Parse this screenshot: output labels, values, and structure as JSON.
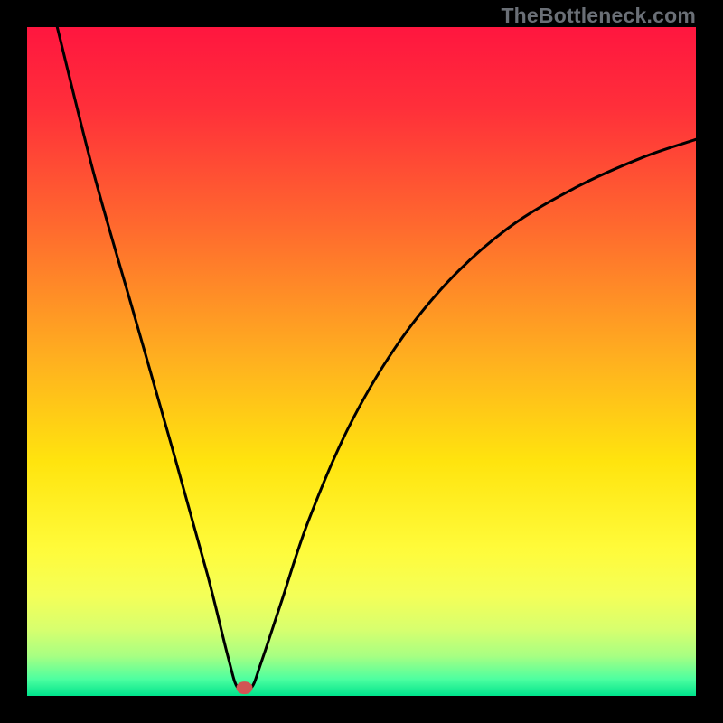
{
  "watermark": "TheBottleneck.com",
  "chart_data": {
    "type": "line",
    "title": "",
    "xlabel": "",
    "ylabel": "",
    "xlim": [
      0,
      100
    ],
    "ylim": [
      0,
      100
    ],
    "gradient_stops": [
      {
        "offset": 0,
        "color": "#ff163f"
      },
      {
        "offset": 0.12,
        "color": "#ff2f3a"
      },
      {
        "offset": 0.3,
        "color": "#ff6a2e"
      },
      {
        "offset": 0.5,
        "color": "#ffb11f"
      },
      {
        "offset": 0.65,
        "color": "#ffe40e"
      },
      {
        "offset": 0.78,
        "color": "#fffb3a"
      },
      {
        "offset": 0.85,
        "color": "#f4ff58"
      },
      {
        "offset": 0.9,
        "color": "#d8ff6e"
      },
      {
        "offset": 0.94,
        "color": "#a8ff82"
      },
      {
        "offset": 0.975,
        "color": "#4dffa0"
      },
      {
        "offset": 1.0,
        "color": "#00e38c"
      }
    ],
    "series": [
      {
        "name": "bottleneck-curve",
        "points": [
          {
            "x": 4.5,
            "y": 100
          },
          {
            "x": 10,
            "y": 78
          },
          {
            "x": 16,
            "y": 57
          },
          {
            "x": 22,
            "y": 36
          },
          {
            "x": 27,
            "y": 18
          },
          {
            "x": 30,
            "y": 6
          },
          {
            "x": 31.5,
            "y": 1.2
          },
          {
            "x": 33.5,
            "y": 1.2
          },
          {
            "x": 35,
            "y": 5
          },
          {
            "x": 38,
            "y": 14
          },
          {
            "x": 42,
            "y": 26
          },
          {
            "x": 48,
            "y": 40
          },
          {
            "x": 55,
            "y": 52
          },
          {
            "x": 63,
            "y": 62
          },
          {
            "x": 72,
            "y": 70
          },
          {
            "x": 82,
            "y": 76
          },
          {
            "x": 92,
            "y": 80.5
          },
          {
            "x": 100,
            "y": 83.2
          }
        ]
      }
    ],
    "marker": {
      "x": 32.5,
      "y": 1.2,
      "color": "#d25454"
    }
  }
}
